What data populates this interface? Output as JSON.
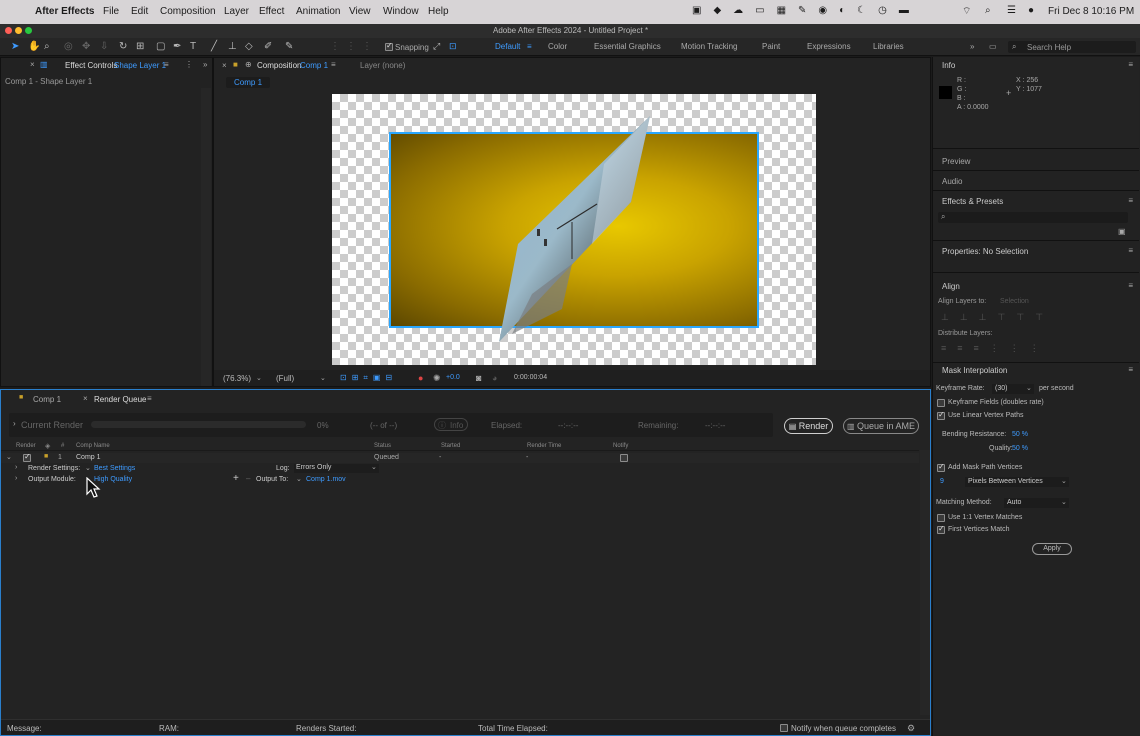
{
  "menubar": {
    "app": "After Effects",
    "items": [
      "File",
      "Edit",
      "Composition",
      "Layer",
      "Effect",
      "Animation",
      "View",
      "Window",
      "Help"
    ],
    "clock": "Fri Dec 8  10:16 PM"
  },
  "window": {
    "title": "Adobe After Effects 2024 - Untitled Project *"
  },
  "toolbar": {
    "snapping": "Snapping",
    "workspaces": [
      "Default",
      "Color",
      "Essential Graphics",
      "Motion Tracking",
      "Paint",
      "Expressions",
      "Libraries"
    ],
    "search_placeholder": "Search Help"
  },
  "left_panel": {
    "tab_label": "Effect Controls",
    "tab_layer": "Shape Layer 1",
    "subtitle": "Comp 1 - Shape Layer 1"
  },
  "comp_panel": {
    "tab_label": "Composition",
    "tab_comp": "Comp 1",
    "layer_tab": "Layer (none)",
    "flow_chip": "Comp 1",
    "zoom": "(76.3%)",
    "resolution": "(Full)",
    "exposure": "+0.0",
    "timecode": "0:00:00:04"
  },
  "bottom_tabs": {
    "comp": "Comp 1",
    "render_queue": "Render Queue"
  },
  "render_queue": {
    "current_render": "Current Render",
    "percent": "0%",
    "of": "(-- of --)",
    "info": "Info",
    "elapsed_label": "Elapsed:",
    "elapsed_value": "--:--:--",
    "remaining_label": "Remaining:",
    "remaining_value": "--:--:--",
    "render_button": "Render",
    "queue_ame_button": "Queue in AME",
    "headers": [
      "Render",
      "#",
      "Comp Name",
      "Status",
      "Started",
      "Render Time",
      "Notify"
    ],
    "item": {
      "num": "1",
      "name": "Comp 1",
      "status": "Queued",
      "started": "-",
      "render_time": "-"
    },
    "render_settings_label": "Render Settings:",
    "render_settings_value": "Best Settings",
    "log_label": "Log:",
    "log_value": "Errors Only",
    "output_module_label": "Output Module:",
    "output_module_value": "High Quality",
    "output_to_label": "Output To:",
    "output_to_value": "Comp 1.mov",
    "footer": {
      "message": "Message:",
      "ram": "RAM:",
      "renders_started": "Renders Started:",
      "total_time": "Total Time Elapsed:",
      "notify": "Notify when queue completes"
    }
  },
  "right_panel": {
    "info_title": "Info",
    "info_r": "R :",
    "info_g": "G :",
    "info_b": "B :",
    "info_a": "A : 0.0000",
    "info_x": "X : 256",
    "info_y": "Y : 1077",
    "preview": "Preview",
    "audio": "Audio",
    "effects_presets": "Effects & Presets",
    "properties": "Properties: No Selection",
    "align": "Align",
    "align_layers_to": "Align Layers to:",
    "align_selection": "Selection",
    "distribute": "Distribute Layers:",
    "mask_interp": "Mask Interpolation",
    "keyframe_rate_label": "Keyframe Rate:",
    "keyframe_rate_value": "(30)",
    "per_second": "per second",
    "keyframe_fields": "Keyframe Fields (doubles rate)",
    "linear_vertex": "Use Linear Vertex Paths",
    "bending_label": "Bending Resistance:",
    "bending_value": "50 %",
    "quality_label": "Quality:",
    "quality_value": "50 %",
    "add_mask": "Add Mask Path Vertices",
    "vertices_num": "9",
    "vertices_mode": "Pixels Between Vertices",
    "matching_label": "Matching Method:",
    "matching_value": "Auto",
    "use_1_1": "Use 1:1 Vertex Matches",
    "first_vertices": "First Vertices Match",
    "apply": "Apply"
  },
  "colors": {
    "accent": "#3e9bff",
    "panel": "#232323",
    "bg": "#1b1b1b",
    "gold": "#c9a300"
  }
}
